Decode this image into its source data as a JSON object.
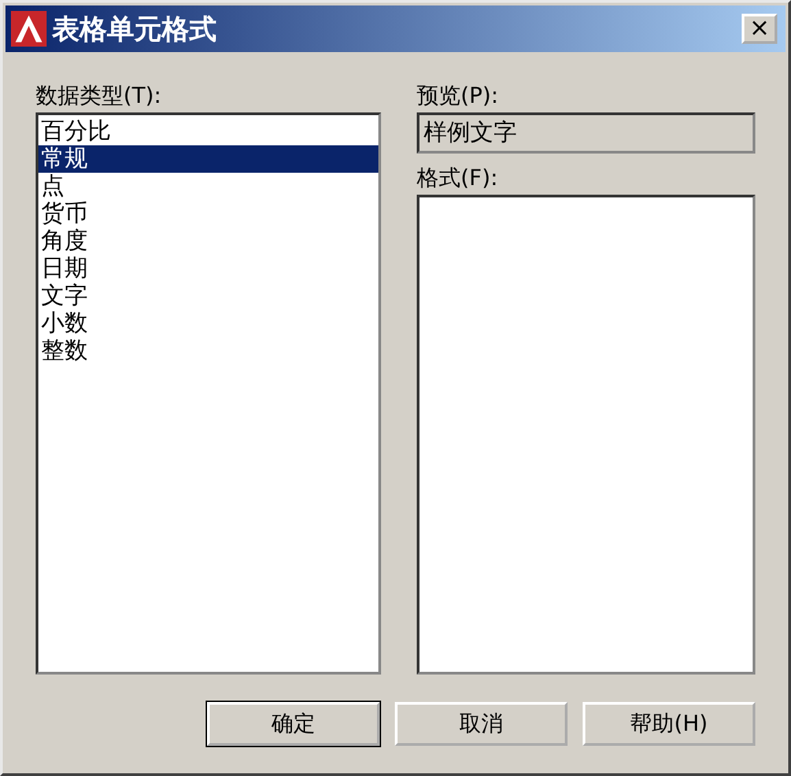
{
  "window": {
    "title": "表格单元格式",
    "close": "×"
  },
  "data_type": {
    "label": "数据类型(T):",
    "items": [
      {
        "label": "百分比",
        "selected": false
      },
      {
        "label": "常规",
        "selected": true
      },
      {
        "label": "点",
        "selected": false
      },
      {
        "label": "货币",
        "selected": false
      },
      {
        "label": "角度",
        "selected": false
      },
      {
        "label": "日期",
        "selected": false
      },
      {
        "label": "文字",
        "selected": false
      },
      {
        "label": "小数",
        "selected": false
      },
      {
        "label": "整数",
        "selected": false
      }
    ]
  },
  "preview": {
    "label": "预览(P):",
    "value": "样例文字"
  },
  "format": {
    "label": "格式(F):"
  },
  "buttons": [
    {
      "label": "确定",
      "default": true
    },
    {
      "label": "取消",
      "default": false
    },
    {
      "label": "帮助(H)",
      "default": false
    }
  ]
}
